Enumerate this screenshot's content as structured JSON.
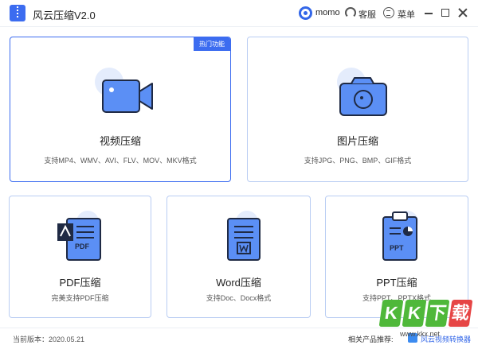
{
  "window": {
    "title": "风云压缩V2.0",
    "username": "momo",
    "support_label": "客服",
    "menu_label": "菜单"
  },
  "cards": {
    "video": {
      "title": "视频压缩",
      "desc": "支持MP4、WMV、AVI、FLV、MOV、MKV格式",
      "badge": "热门功能"
    },
    "image": {
      "title": "图片压缩",
      "desc": "支持JPG、PNG、BMP、GIF格式"
    },
    "pdf": {
      "title": "PDF压缩",
      "desc": "完美支持PDF压缩",
      "icon_text": "PDF"
    },
    "word": {
      "title": "Word压缩",
      "desc": "支持Doc、Docx格式"
    },
    "ppt": {
      "title": "PPT压缩",
      "desc": "支持PPT、PPTX格式",
      "icon_text": "PPT"
    }
  },
  "footer": {
    "version": "当前版本：2020.05.21",
    "related_label": "相关产品推荐:",
    "related_product": "风云视频转换器"
  },
  "watermark": {
    "letters": [
      "K",
      "K",
      "下",
      "载"
    ],
    "url": "www.kkx.net"
  },
  "colors": {
    "accent": "#3c6cf0",
    "card_border": "#b9cdf3",
    "icon_blue": "#5b8ff5",
    "icon_halo": "#e4ecfc",
    "watermark_green": "#4fb83a"
  }
}
